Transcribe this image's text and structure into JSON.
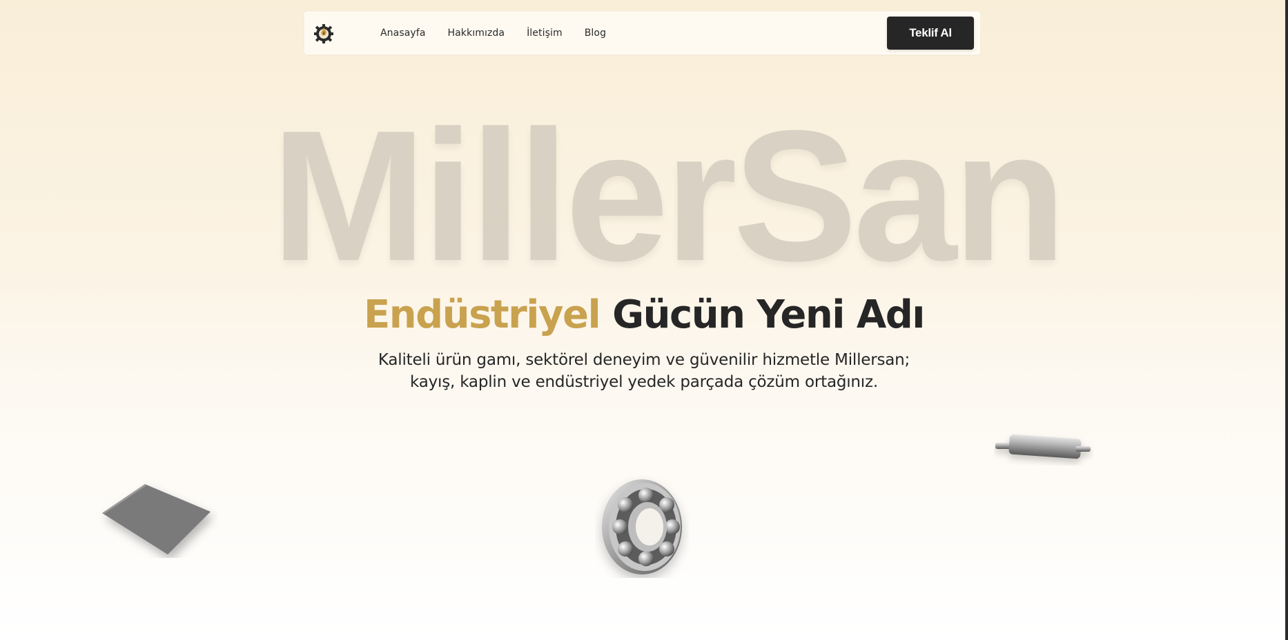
{
  "navbar": {
    "logo_icon": "gear-flame-logo-icon",
    "links": [
      "Anasayfa",
      "Hakkımızda",
      "İletişim",
      "Blog"
    ],
    "cta_label": "Teklif Al"
  },
  "hero": {
    "brand_watermark": "MillerSan",
    "headline_accent": "Endüstriyel",
    "headline_rest": "Gücün Yeni Adı",
    "subtitle_line1": "Kaliteli ürün gamı, sektörel deneyim ve güvenilir hizmetle Millersan;",
    "subtitle_line2": "kayış, kaplin ve endüstriyel yedek parçada çözüm ortağınız."
  },
  "products": [
    {
      "icon": "metal-plate-image"
    },
    {
      "icon": "ball-bearing-image"
    },
    {
      "icon": "steel-roller-shaft-image"
    }
  ],
  "colors": {
    "accent": "#c9a24f",
    "dark": "#262626",
    "watermark": "#d9d1c4",
    "background_top": "#f9eed8"
  }
}
